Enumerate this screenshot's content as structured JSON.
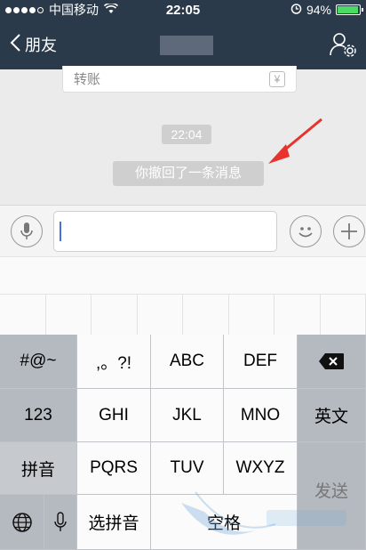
{
  "status_bar": {
    "carrier": "中国移动",
    "time": "22:05",
    "battery": "94%",
    "battery_level": 0.94
  },
  "nav": {
    "back_label": "朋友"
  },
  "chat": {
    "transfer_label": "转账",
    "timestamp": "22:04",
    "recall_notice": "你撤回了一条消息"
  },
  "input": {
    "value": ""
  },
  "keyboard": {
    "row1": [
      "#@~",
      ",。?!",
      "ABC",
      "DEF"
    ],
    "row2": [
      "123",
      "GHI",
      "JKL",
      "MNO",
      "英文"
    ],
    "row3": [
      "拼音",
      "PQRS",
      "TUV",
      "WXYZ",
      "发送"
    ],
    "row4": [
      "选拼音",
      "空格"
    ]
  },
  "colors": {
    "navbar": "#2b3a4a",
    "pill": "#cfcfcf",
    "arrow": "#e8322c"
  }
}
